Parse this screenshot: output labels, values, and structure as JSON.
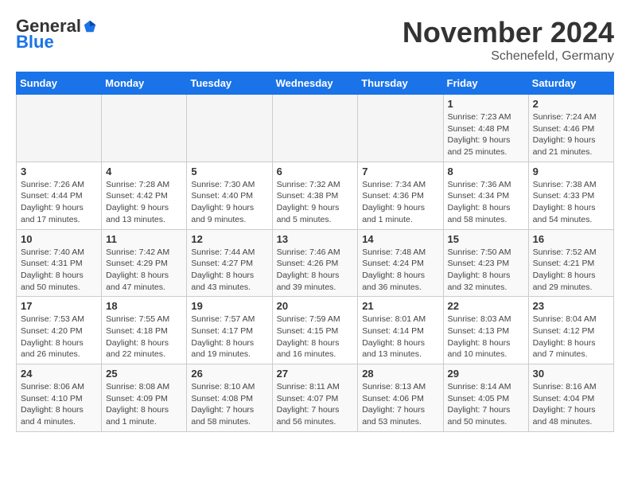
{
  "header": {
    "logo_general": "General",
    "logo_blue": "Blue",
    "month_title": "November 2024",
    "subtitle": "Schenefeld, Germany"
  },
  "weekdays": [
    "Sunday",
    "Monday",
    "Tuesday",
    "Wednesday",
    "Thursday",
    "Friday",
    "Saturday"
  ],
  "weeks": [
    [
      {
        "day": "",
        "info": ""
      },
      {
        "day": "",
        "info": ""
      },
      {
        "day": "",
        "info": ""
      },
      {
        "day": "",
        "info": ""
      },
      {
        "day": "",
        "info": ""
      },
      {
        "day": "1",
        "info": "Sunrise: 7:23 AM\nSunset: 4:48 PM\nDaylight: 9 hours\nand 25 minutes."
      },
      {
        "day": "2",
        "info": "Sunrise: 7:24 AM\nSunset: 4:46 PM\nDaylight: 9 hours\nand 21 minutes."
      }
    ],
    [
      {
        "day": "3",
        "info": "Sunrise: 7:26 AM\nSunset: 4:44 PM\nDaylight: 9 hours\nand 17 minutes."
      },
      {
        "day": "4",
        "info": "Sunrise: 7:28 AM\nSunset: 4:42 PM\nDaylight: 9 hours\nand 13 minutes."
      },
      {
        "day": "5",
        "info": "Sunrise: 7:30 AM\nSunset: 4:40 PM\nDaylight: 9 hours\nand 9 minutes."
      },
      {
        "day": "6",
        "info": "Sunrise: 7:32 AM\nSunset: 4:38 PM\nDaylight: 9 hours\nand 5 minutes."
      },
      {
        "day": "7",
        "info": "Sunrise: 7:34 AM\nSunset: 4:36 PM\nDaylight: 9 hours\nand 1 minute."
      },
      {
        "day": "8",
        "info": "Sunrise: 7:36 AM\nSunset: 4:34 PM\nDaylight: 8 hours\nand 58 minutes."
      },
      {
        "day": "9",
        "info": "Sunrise: 7:38 AM\nSunset: 4:33 PM\nDaylight: 8 hours\nand 54 minutes."
      }
    ],
    [
      {
        "day": "10",
        "info": "Sunrise: 7:40 AM\nSunset: 4:31 PM\nDaylight: 8 hours\nand 50 minutes."
      },
      {
        "day": "11",
        "info": "Sunrise: 7:42 AM\nSunset: 4:29 PM\nDaylight: 8 hours\nand 47 minutes."
      },
      {
        "day": "12",
        "info": "Sunrise: 7:44 AM\nSunset: 4:27 PM\nDaylight: 8 hours\nand 43 minutes."
      },
      {
        "day": "13",
        "info": "Sunrise: 7:46 AM\nSunset: 4:26 PM\nDaylight: 8 hours\nand 39 minutes."
      },
      {
        "day": "14",
        "info": "Sunrise: 7:48 AM\nSunset: 4:24 PM\nDaylight: 8 hours\nand 36 minutes."
      },
      {
        "day": "15",
        "info": "Sunrise: 7:50 AM\nSunset: 4:23 PM\nDaylight: 8 hours\nand 32 minutes."
      },
      {
        "day": "16",
        "info": "Sunrise: 7:52 AM\nSunset: 4:21 PM\nDaylight: 8 hours\nand 29 minutes."
      }
    ],
    [
      {
        "day": "17",
        "info": "Sunrise: 7:53 AM\nSunset: 4:20 PM\nDaylight: 8 hours\nand 26 minutes."
      },
      {
        "day": "18",
        "info": "Sunrise: 7:55 AM\nSunset: 4:18 PM\nDaylight: 8 hours\nand 22 minutes."
      },
      {
        "day": "19",
        "info": "Sunrise: 7:57 AM\nSunset: 4:17 PM\nDaylight: 8 hours\nand 19 minutes."
      },
      {
        "day": "20",
        "info": "Sunrise: 7:59 AM\nSunset: 4:15 PM\nDaylight: 8 hours\nand 16 minutes."
      },
      {
        "day": "21",
        "info": "Sunrise: 8:01 AM\nSunset: 4:14 PM\nDaylight: 8 hours\nand 13 minutes."
      },
      {
        "day": "22",
        "info": "Sunrise: 8:03 AM\nSunset: 4:13 PM\nDaylight: 8 hours\nand 10 minutes."
      },
      {
        "day": "23",
        "info": "Sunrise: 8:04 AM\nSunset: 4:12 PM\nDaylight: 8 hours\nand 7 minutes."
      }
    ],
    [
      {
        "day": "24",
        "info": "Sunrise: 8:06 AM\nSunset: 4:10 PM\nDaylight: 8 hours\nand 4 minutes."
      },
      {
        "day": "25",
        "info": "Sunrise: 8:08 AM\nSunset: 4:09 PM\nDaylight: 8 hours\nand 1 minute."
      },
      {
        "day": "26",
        "info": "Sunrise: 8:10 AM\nSunset: 4:08 PM\nDaylight: 7 hours\nand 58 minutes."
      },
      {
        "day": "27",
        "info": "Sunrise: 8:11 AM\nSunset: 4:07 PM\nDaylight: 7 hours\nand 56 minutes."
      },
      {
        "day": "28",
        "info": "Sunrise: 8:13 AM\nSunset: 4:06 PM\nDaylight: 7 hours\nand 53 minutes."
      },
      {
        "day": "29",
        "info": "Sunrise: 8:14 AM\nSunset: 4:05 PM\nDaylight: 7 hours\nand 50 minutes."
      },
      {
        "day": "30",
        "info": "Sunrise: 8:16 AM\nSunset: 4:04 PM\nDaylight: 7 hours\nand 48 minutes."
      }
    ]
  ]
}
